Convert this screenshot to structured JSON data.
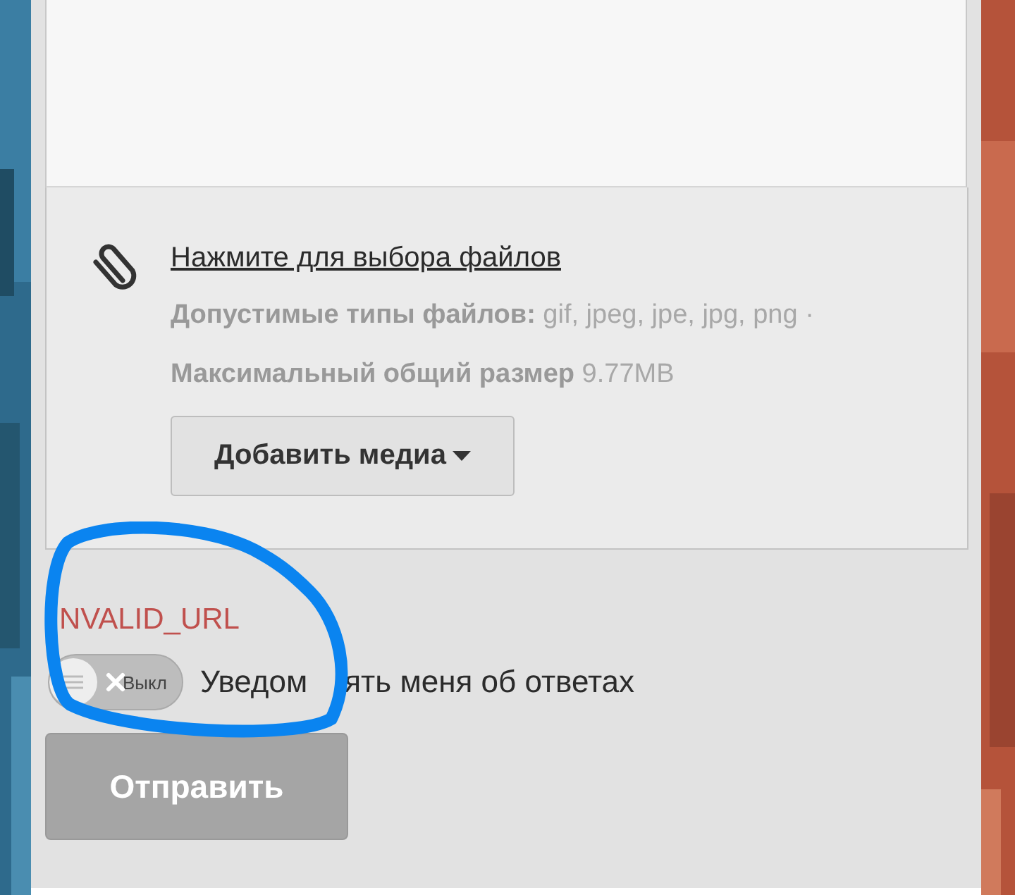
{
  "editor": {
    "attach_link": "Нажмите для выбора файлов",
    "file_info": "**Допустимые типы файлов:** gif, jpeg, jpe, jpg, png · **Максимальный общий размер** 9.77MB",
    "add_media_button": "Добавить медиа"
  },
  "error": "NVALID_URL",
  "notify_toggle": {
    "on": false,
    "state_label": "Выкл",
    "label_parts": [
      "Уведом",
      "ять меня об ответах"
    ]
  },
  "submit_button": {
    "label": "Отправить",
    "disabled": true
  }
}
